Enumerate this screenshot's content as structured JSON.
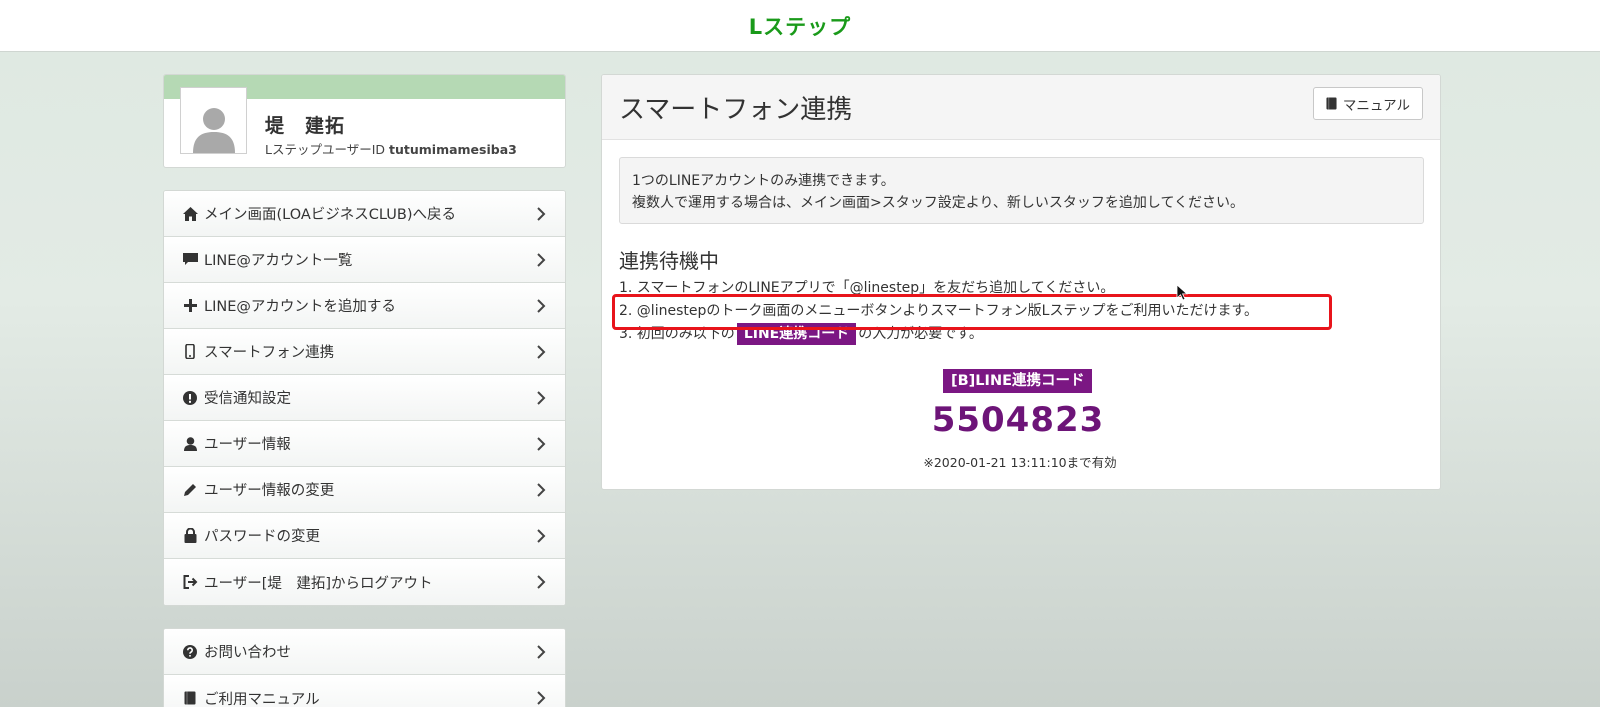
{
  "header": {
    "logo": "Lステップ"
  },
  "profile": {
    "name": "堤　建拓",
    "id_label": "LステップユーザーID",
    "id_value": "tutumimamesiba3"
  },
  "menu": {
    "items": [
      {
        "label": "メイン画面(LOAビジネスCLUB)へ戻る",
        "icon": "home-icon"
      },
      {
        "label": "LINE@アカウント一覧",
        "icon": "comment-icon"
      },
      {
        "label": "LINE@アカウントを追加する",
        "icon": "plus-icon"
      },
      {
        "label": "スマートフォン連携",
        "icon": "smartphone-icon"
      },
      {
        "label": "受信通知設定",
        "icon": "alert-icon"
      },
      {
        "label": "ユーザー情報",
        "icon": "user-icon"
      },
      {
        "label": "ユーザー情報の変更",
        "icon": "pencil-icon"
      },
      {
        "label": "パスワードの変更",
        "icon": "lock-icon"
      },
      {
        "label": "ユーザー[堤　建拓]からログアウト",
        "icon": "logout-icon"
      }
    ]
  },
  "menu2": {
    "items": [
      {
        "label": "お問い合わせ",
        "icon": "question-icon"
      },
      {
        "label": "ご利用マニュアル",
        "icon": "book-icon"
      }
    ]
  },
  "panel": {
    "title": "スマートフォン連携",
    "manual_label": "マニュアル",
    "notice_line1": "1つのLINEアカウントのみ連携できます。",
    "notice_line2": "複数人で運用する場合は、メイン画面>スタッフ設定より、新しいスタッフを追加してください。",
    "status_title": "連携待機中",
    "step1": "1. スマートフォンのLINEアプリで「@linestep」を友だち追加してください。",
    "step2": "2. @linestepのトーク画面のメニューボタンよりスマートフォン版Lステップをご利用いただけます。",
    "step3_pre": "3. 初回のみ以下の",
    "step3_tag": "LINE連携コード",
    "step3_post": "の入力が必要です。",
    "code_label": "[B]LINE連携コード",
    "code_value": "5504823",
    "expiry": "※2020-01-21 13:11:10まで有効"
  },
  "colors": {
    "brand_green": "#1a9a1a",
    "code_purple": "#7b1783",
    "highlight_red": "#e8141b"
  }
}
